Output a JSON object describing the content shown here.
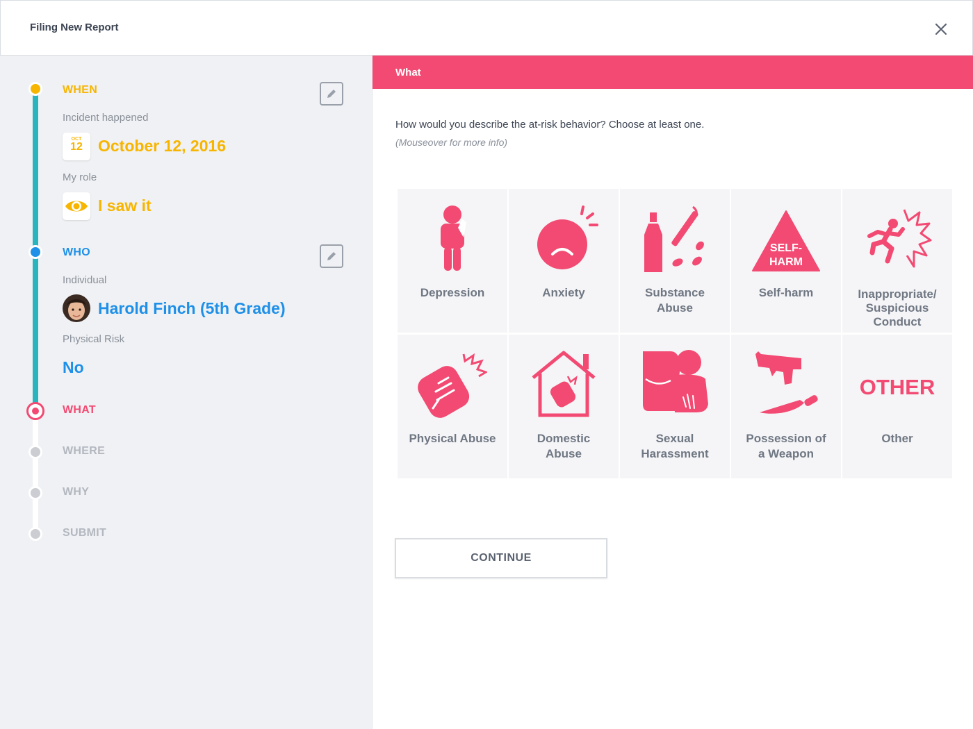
{
  "header": {
    "title": "Filing New Report",
    "close_icon": "close-icon"
  },
  "sidebar": {
    "steps": [
      {
        "label": "WHEN",
        "state": "done",
        "color": "#f7b500"
      },
      {
        "label": "WHO",
        "state": "done",
        "color": "#1e90e8"
      },
      {
        "label": "WHAT",
        "state": "current",
        "color": "#f24a72"
      },
      {
        "label": "WHERE",
        "state": "pending"
      },
      {
        "label": "WHY",
        "state": "pending"
      },
      {
        "label": "SUBMIT",
        "state": "pending"
      }
    ],
    "when": {
      "incident_label": "Incident happened",
      "calendar_month": "OCT",
      "calendar_day": "12",
      "date_value": "October 12, 2016",
      "role_label": "My role",
      "role_value": "I saw it",
      "role_icon": "eye-icon"
    },
    "who": {
      "individual_label": "Individual",
      "individual_value": "Harold Finch (5th Grade)",
      "risk_label": "Physical Risk",
      "risk_value": "No"
    }
  },
  "main": {
    "section_title": "What",
    "question": "How would you describe the at-risk behavior? Choose at least one.",
    "hint": "(Mouseover for more info)",
    "options": [
      {
        "label_lines": [
          "Depression"
        ],
        "icon": "depression-icon"
      },
      {
        "label_lines": [
          "Anxiety"
        ],
        "icon": "anxiety-icon"
      },
      {
        "label_lines": [
          "Substance",
          "Abuse"
        ],
        "icon": "substance-abuse-icon"
      },
      {
        "label_lines": [
          "Self-harm"
        ],
        "icon": "self-harm-icon",
        "icon_text": [
          "SELF-",
          "HARM"
        ]
      },
      {
        "label_lines": [
          "Inappropriate/",
          "Suspicious",
          "Conduct"
        ],
        "icon": "inappropriate-conduct-icon"
      },
      {
        "label_lines": [
          "Physical Abuse"
        ],
        "icon": "physical-abuse-icon"
      },
      {
        "label_lines": [
          "Domestic",
          "Abuse"
        ],
        "icon": "domestic-abuse-icon"
      },
      {
        "label_lines": [
          "Sexual",
          "Harassment"
        ],
        "icon": "sexual-harassment-icon"
      },
      {
        "label_lines": [
          "Possession of",
          "a Weapon"
        ],
        "icon": "weapon-icon"
      },
      {
        "label_lines": [
          "Other"
        ],
        "icon": "other-icon",
        "icon_text": [
          "OTHER"
        ]
      }
    ],
    "continue_label": "CONTINUE"
  },
  "colors": {
    "accent": "#f24a72",
    "when": "#f7b500",
    "who": "#1e90e8",
    "rail": "#28b5bd"
  }
}
